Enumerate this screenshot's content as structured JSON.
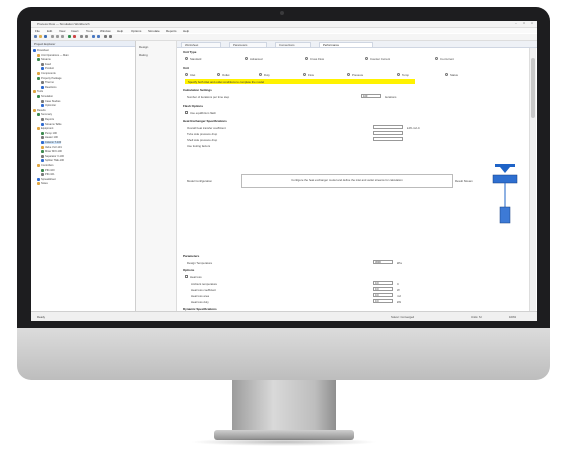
{
  "app": {
    "title": "Process Flow — Simulation Workbench",
    "window_buttons": [
      "–",
      "□",
      "×"
    ]
  },
  "menu": [
    "File",
    "Edit",
    "View",
    "Insert",
    "Tools",
    "Window",
    "Help",
    "Options",
    "Simulate",
    "Reports",
    "Help"
  ],
  "tree": {
    "header": "Project Explorer",
    "nodes": [
      "Flowsheet",
      "Unit Operations — Main",
      "Streams",
      "Feed",
      "Product",
      "Components",
      "Property Package",
      "Thermo",
      "Reactions",
      "Tools",
      "Simulation",
      "Case Studies",
      "Optimizer",
      "Results",
      "Summary",
      "Reports",
      "Streams Table",
      "Equipment",
      "Pump 100",
      "Heater 100",
      "Column T-100",
      "Valve VLV-101",
      "Mixer MIX-100",
      "Separator V-100",
      "Splitter TEE-100",
      "Controllers",
      "PID-100",
      "PID-101",
      "Spreadsheet",
      "Notes"
    ]
  },
  "nav": {
    "items": [
      "Design",
      "Rating"
    ]
  },
  "tabs": [
    "Worksheet",
    "Parameters",
    "Connections",
    "Performance"
  ],
  "form": {
    "section_1": "Unit Type",
    "radio_options": [
      "Standard",
      "Advanced",
      "Cross Flow",
      "Counter Current",
      "Co-Current"
    ],
    "section_2": "Unit",
    "col_headers": [
      "Inlet",
      "Outlet",
      "Duty",
      "Flow",
      "Pressure",
      "Temp",
      "Status"
    ],
    "highlight_note": "Specify both inlet and outlet conditions to complete the model",
    "section_3": "Calculation Settings",
    "calc_label": "Number of iterations per time step",
    "calc_value": "100",
    "calc_unit": "iterations",
    "section_4": "Flash Options",
    "flash_opt": "Use equilibrium flash",
    "section_5": "Heat Exchanger Specifications",
    "spec_rows": [
      {
        "label": "Overall heat transfer coefficient",
        "value": "",
        "unit": "kJ/h-m2-C"
      },
      {
        "label": "Tube side pressure drop",
        "value": "",
        "unit": ""
      },
      {
        "label": "Shell side pressure drop",
        "value": "",
        "unit": ""
      }
    ],
    "spec_note": "Use fouling factors",
    "diagram_caption": "Configure the heat exchanger model and define the inlet and outlet streams for calculation",
    "diagram_left_label": "Model Configuration",
    "diagram_right_label": "Result Stream",
    "section_6": "Parameters",
    "param_label": "Design Temperature",
    "param_value": "3000",
    "param_unit": "kPa",
    "section_7": "Options",
    "check_label": "Heat loss",
    "sub_rows": [
      {
        "label": "Ambient temperature",
        "value": "0.0",
        "unit": "C"
      },
      {
        "label": "Heat loss coefficient",
        "value": "0.0",
        "unit": "W"
      },
      {
        "label": "Heat loss area",
        "value": "0.0",
        "unit": "m2"
      },
      {
        "label": "Heat loss duty",
        "value": "0.0",
        "unit": "kW"
      }
    ],
    "section_8": "Dynamic Specifications"
  },
  "status": {
    "left": "Ready",
    "center": "Solver: Converged",
    "right_1": "Units: SI",
    "right_2": "100%"
  },
  "colors": {
    "highlight": "#fff200",
    "bezel": "#1d1d1f",
    "diagram_blue": "#1e63c7"
  }
}
